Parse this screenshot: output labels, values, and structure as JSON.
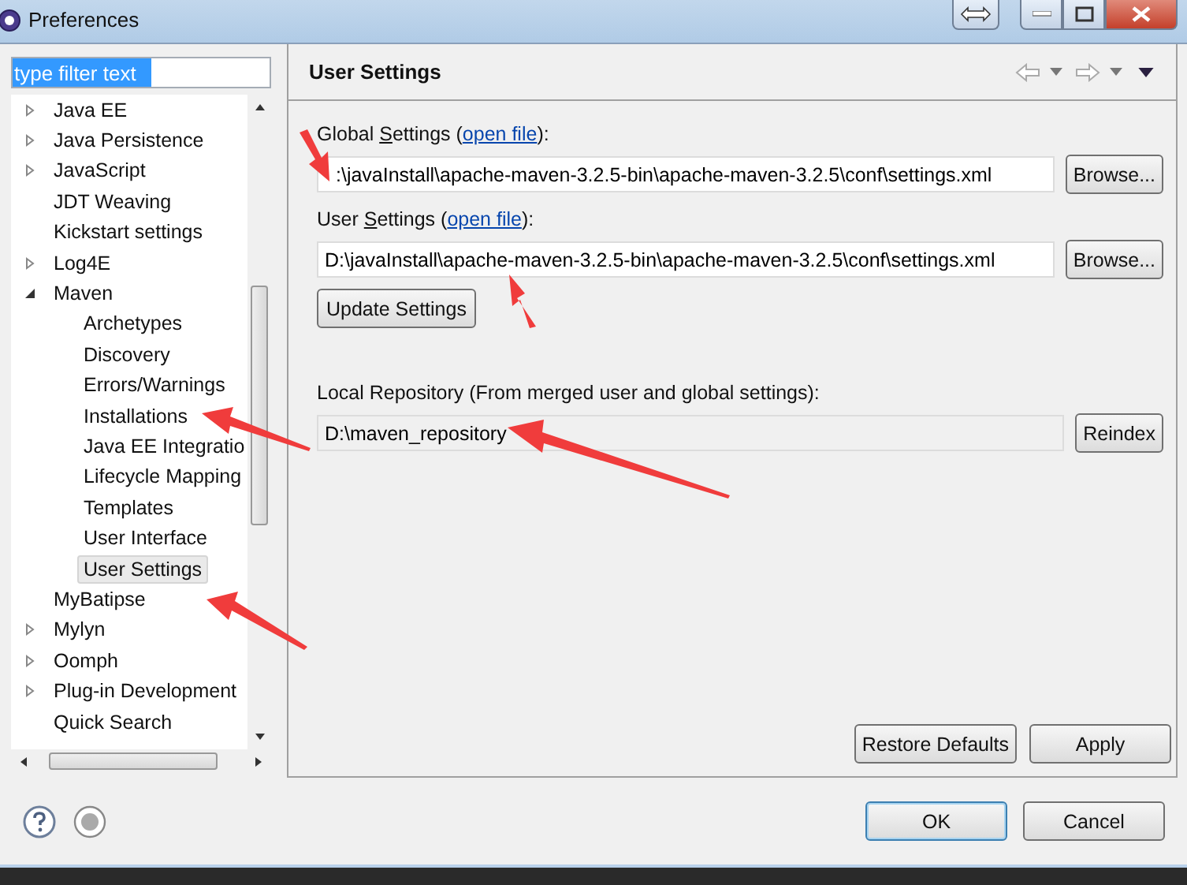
{
  "window": {
    "title": "Preferences"
  },
  "filter": {
    "value": "type filter text"
  },
  "tree": [
    {
      "label": "Java EE",
      "expanded": false,
      "selected": false
    },
    {
      "label": "Java Persistence",
      "expanded": false,
      "selected": false
    },
    {
      "label": "JavaScript",
      "expanded": false,
      "selected": false
    },
    {
      "label": "JDT Weaving",
      "selected": false
    },
    {
      "label": "Kickstart settings",
      "selected": false
    },
    {
      "label": "Log4E",
      "expanded": false,
      "selected": false
    },
    {
      "label": "Maven",
      "expanded": true,
      "selected": false,
      "children": [
        {
          "label": "Archetypes",
          "selected": false
        },
        {
          "label": "Discovery",
          "selected": false
        },
        {
          "label": "Errors/Warnings",
          "selected": false
        },
        {
          "label": "Installations",
          "selected": false
        },
        {
          "label": "Java EE Integratio",
          "selected": false
        },
        {
          "label": "Lifecycle Mapping",
          "selected": false
        },
        {
          "label": "Templates",
          "selected": false
        },
        {
          "label": "User Interface",
          "selected": false
        },
        {
          "label": "User Settings",
          "selected": true
        }
      ]
    },
    {
      "label": "MyBatipse",
      "selected": false
    },
    {
      "label": "Mylyn",
      "expanded": false,
      "selected": false
    },
    {
      "label": "Oomph",
      "expanded": false,
      "selected": false
    },
    {
      "label": "Plug-in Development",
      "expanded": false,
      "selected": false
    },
    {
      "label": "Quick Search",
      "selected": false
    }
  ],
  "page": {
    "title": "User Settings",
    "global_settings": {
      "label": "Global **S**ettings (",
      "link": "open file",
      "label_end": "):",
      "value": ":\\javaInstall\\apache-maven-3.2.5-bin\\apache-maven-3.2.5\\conf\\settings.xml",
      "button": "Browse..."
    },
    "user_settings": {
      "label": "User **S**ettings (",
      "link": "open file",
      "label_end": "):",
      "value": "D:\\javaInstall\\apache-maven-3.2.5-bin\\apache-maven-3.2.5\\conf\\settings.xml",
      "button": "Browse..."
    },
    "update_button": "Update Settings",
    "local_repository": {
      "label": "Local Repository (From merged user and global settings):",
      "value": "D:\\maven_repository",
      "button": "Reindex"
    },
    "buttons": [
      "Restore Defaults",
      "Apply"
    ]
  },
  "dialog_buttons": [
    {
      "label": "OK",
      "default": true
    },
    {
      "label": "Cancel",
      "default": false
    }
  ]
}
